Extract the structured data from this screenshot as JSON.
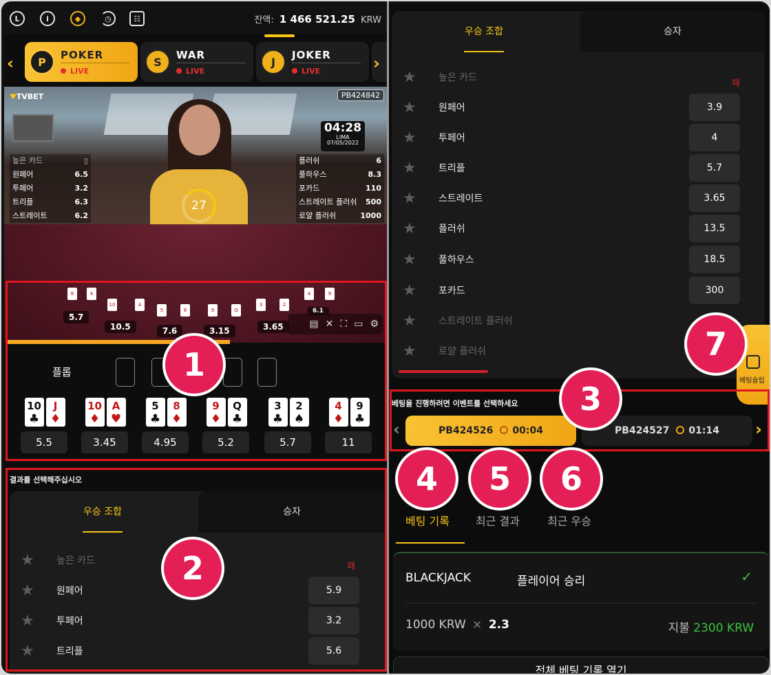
{
  "topbar": {
    "icons": [
      "live-icon",
      "info-icon",
      "target-icon",
      "history-icon",
      "calendar-icon"
    ],
    "balance_label": "잔액:",
    "balance_value": "1 466 521.25",
    "currency": "KRW"
  },
  "games": [
    {
      "name": "POKER",
      "status": "LIVE",
      "active": true
    },
    {
      "name": "WAR",
      "status": "LIVE",
      "active": false
    },
    {
      "name": "JOKER",
      "status": "LIVE",
      "active": false
    }
  ],
  "video": {
    "brand": "TVBET",
    "round_id": "PB424842",
    "timer": "27",
    "clock_time": "04:28",
    "clock_city": "LIMA",
    "clock_date": "07/05/2022",
    "left_odds": [
      {
        "name": "높은 카드",
        "value": ""
      },
      {
        "name": "원페어",
        "value": "6.5"
      },
      {
        "name": "투페어",
        "value": "3.2"
      },
      {
        "name": "트리플",
        "value": "6.3"
      },
      {
        "name": "스트레이트",
        "value": "6.2"
      }
    ],
    "right_odds": [
      {
        "name": "플러쉬",
        "value": "6"
      },
      {
        "name": "풀하우스",
        "value": "8.3"
      },
      {
        "name": "포카드",
        "value": "110"
      },
      {
        "name": "스트레이트 플러쉬",
        "value": "500"
      },
      {
        "name": "로얄 플러쉬",
        "value": "1000"
      }
    ],
    "table_odds": [
      "5.7",
      "10.5",
      "7.6",
      "3.15",
      "3.65",
      "6.1"
    ]
  },
  "community": {
    "label": "플롭"
  },
  "hands": [
    {
      "cards": [
        {
          "r": "10",
          "s": "♣",
          "red": false
        },
        {
          "r": "J",
          "s": "♦",
          "red": true
        }
      ],
      "odd": "5.5"
    },
    {
      "cards": [
        {
          "r": "10",
          "s": "♦",
          "red": true
        },
        {
          "r": "A",
          "s": "♥",
          "red": true
        }
      ],
      "odd": "3.45"
    },
    {
      "cards": [
        {
          "r": "5",
          "s": "♣",
          "red": false
        },
        {
          "r": "8",
          "s": "♦",
          "red": true
        }
      ],
      "odd": "4.95"
    },
    {
      "cards": [
        {
          "r": "9",
          "s": "♦",
          "red": true
        },
        {
          "r": "Q",
          "s": "♣",
          "red": false
        }
      ],
      "odd": "5.2"
    },
    {
      "cards": [
        {
          "r": "3",
          "s": "♣",
          "red": false
        },
        {
          "r": "2",
          "s": "♠",
          "red": false
        }
      ],
      "odd": "5.7"
    },
    {
      "cards": [
        {
          "r": "4",
          "s": "♦",
          "red": true
        },
        {
          "r": "9",
          "s": "♣",
          "red": false
        }
      ],
      "odd": "11"
    }
  ],
  "left_panel": {
    "prompt": "결과를 선택해주십시오",
    "tab_active": "우승 조합",
    "tab_other": "승자",
    "rows": [
      {
        "name": "높은 카드",
        "odd": "패",
        "locked": true
      },
      {
        "name": "원페어",
        "odd": "5.9",
        "locked": false
      },
      {
        "name": "투페어",
        "odd": "3.2",
        "locked": false
      },
      {
        "name": "트리플",
        "odd": "5.6",
        "locked": false
      }
    ]
  },
  "right_panel": {
    "tab_active": "우승 조합",
    "tab_other": "승자",
    "rows": [
      {
        "name": "높은 카드",
        "odd": "패",
        "locked": true
      },
      {
        "name": "원페어",
        "odd": "3.9",
        "locked": false
      },
      {
        "name": "투페어",
        "odd": "4",
        "locked": false
      },
      {
        "name": "트리플",
        "odd": "5.7",
        "locked": false
      },
      {
        "name": "스트레이트",
        "odd": "3.65",
        "locked": false
      },
      {
        "name": "플러쉬",
        "odd": "13.5",
        "locked": false
      },
      {
        "name": "풀하우스",
        "odd": "18.5",
        "locked": false
      },
      {
        "name": "포카드",
        "odd": "300",
        "locked": false
      },
      {
        "name": "스트레이트 플러쉬",
        "odd": "",
        "locked": true
      },
      {
        "name": "로얄 플러쉬",
        "odd": "",
        "locked": true
      }
    ]
  },
  "events": {
    "prompt": "베팅을 진행하려면 이벤트를 선택하세요",
    "items": [
      {
        "id": "PB424526",
        "time": "00:04",
        "active": true
      },
      {
        "id": "PB424527",
        "time": "01:14",
        "active": false
      }
    ]
  },
  "history_tabs": [
    "베팅 기록",
    "최근 결과",
    "최근 우승"
  ],
  "bet": {
    "game": "BLACKJACK",
    "outcome": "플레이어 승리",
    "stake": "1000 KRW",
    "times": "×",
    "odd": "2.3",
    "payout_label": "지불",
    "payout_value": "2300 KRW"
  },
  "open_all": "전체 베팅 기록 열기",
  "betslip": "베팅슬립",
  "badges": [
    "1",
    "2",
    "3",
    "4",
    "5",
    "6",
    "7"
  ],
  "colors": {
    "accent": "#f5c518",
    "live": "#e62e2e",
    "highlight": "#e1161d",
    "badge": "#e31f55",
    "win": "#3cc23c"
  }
}
